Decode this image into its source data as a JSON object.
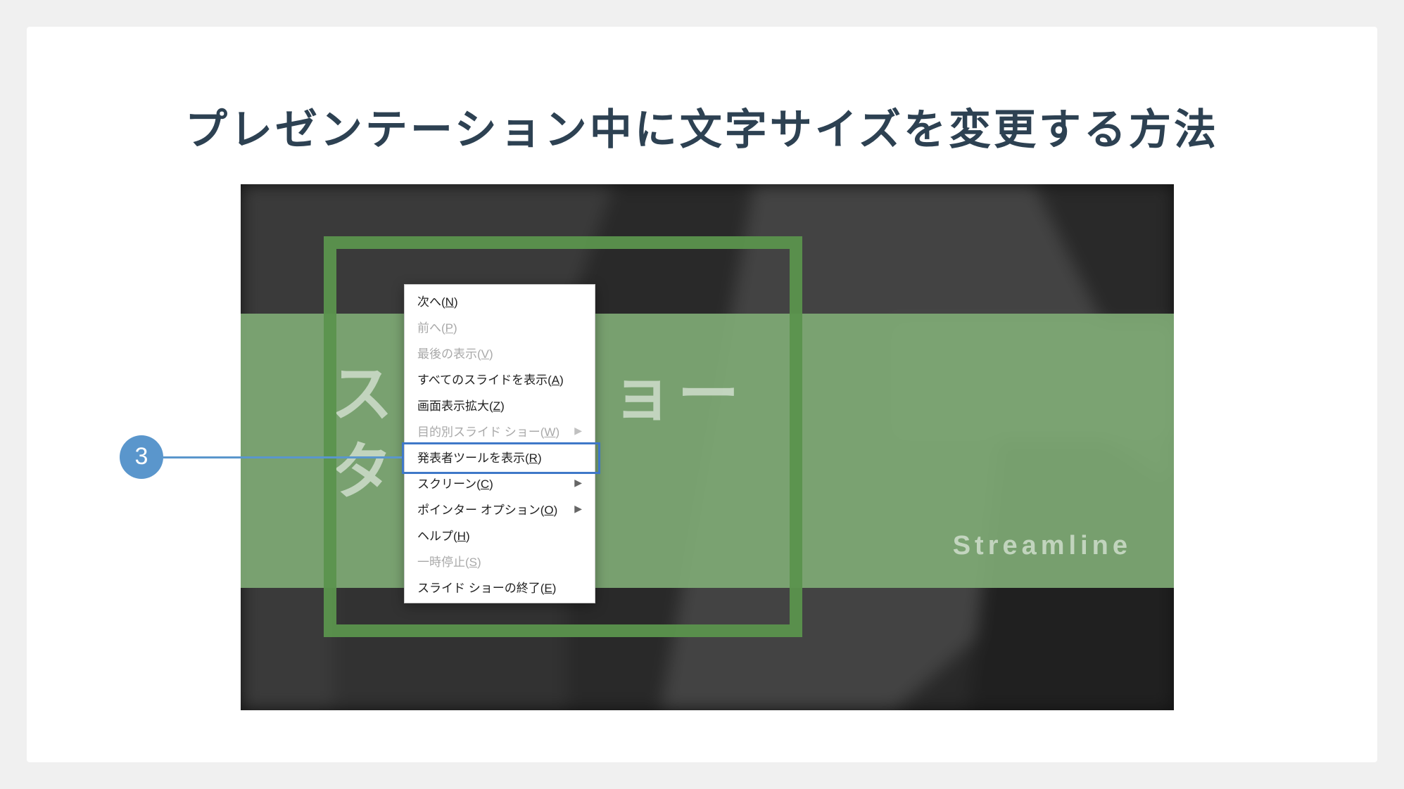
{
  "title": "プレゼンテーション中に文字サイズを変更する方法",
  "slide_bg": {
    "title_line1": "ス",
    "title_line2": "ター",
    "title_mid": "ョー",
    "brand": "Streamline"
  },
  "menu": {
    "items": [
      {
        "pre": "次へ(",
        "u": "N",
        "post": ")",
        "disabled": false,
        "submenu": false
      },
      {
        "pre": "前へ(",
        "u": "P",
        "post": ")",
        "disabled": true,
        "submenu": false
      },
      {
        "pre": "最後の表示(",
        "u": "V",
        "post": ")",
        "disabled": true,
        "submenu": false
      },
      {
        "pre": "すべてのスライドを表示(",
        "u": "A",
        "post": ")",
        "disabled": false,
        "submenu": false
      },
      {
        "pre": "画面表示拡大(",
        "u": "Z",
        "post": ")",
        "disabled": false,
        "submenu": false
      },
      {
        "pre": "目的別スライド ショー(",
        "u": "W",
        "post": ")",
        "disabled": true,
        "submenu": true
      },
      {
        "pre": "発表者ツールを表示(",
        "u": "R",
        "post": ")",
        "disabled": false,
        "submenu": false
      },
      {
        "pre": "スクリーン(",
        "u": "C",
        "post": ")",
        "disabled": false,
        "submenu": true
      },
      {
        "pre": "ポインター オプション(",
        "u": "O",
        "post": ")",
        "disabled": false,
        "submenu": true
      },
      {
        "pre": "ヘルプ(",
        "u": "H",
        "post": ")",
        "disabled": false,
        "submenu": false
      },
      {
        "pre": "一時停止(",
        "u": "S",
        "post": ")",
        "disabled": true,
        "submenu": false
      },
      {
        "pre": "スライド ショーの終了(",
        "u": "E",
        "post": ")",
        "disabled": false,
        "submenu": false
      }
    ]
  },
  "callout": {
    "badge": "3",
    "target_index": 6
  }
}
